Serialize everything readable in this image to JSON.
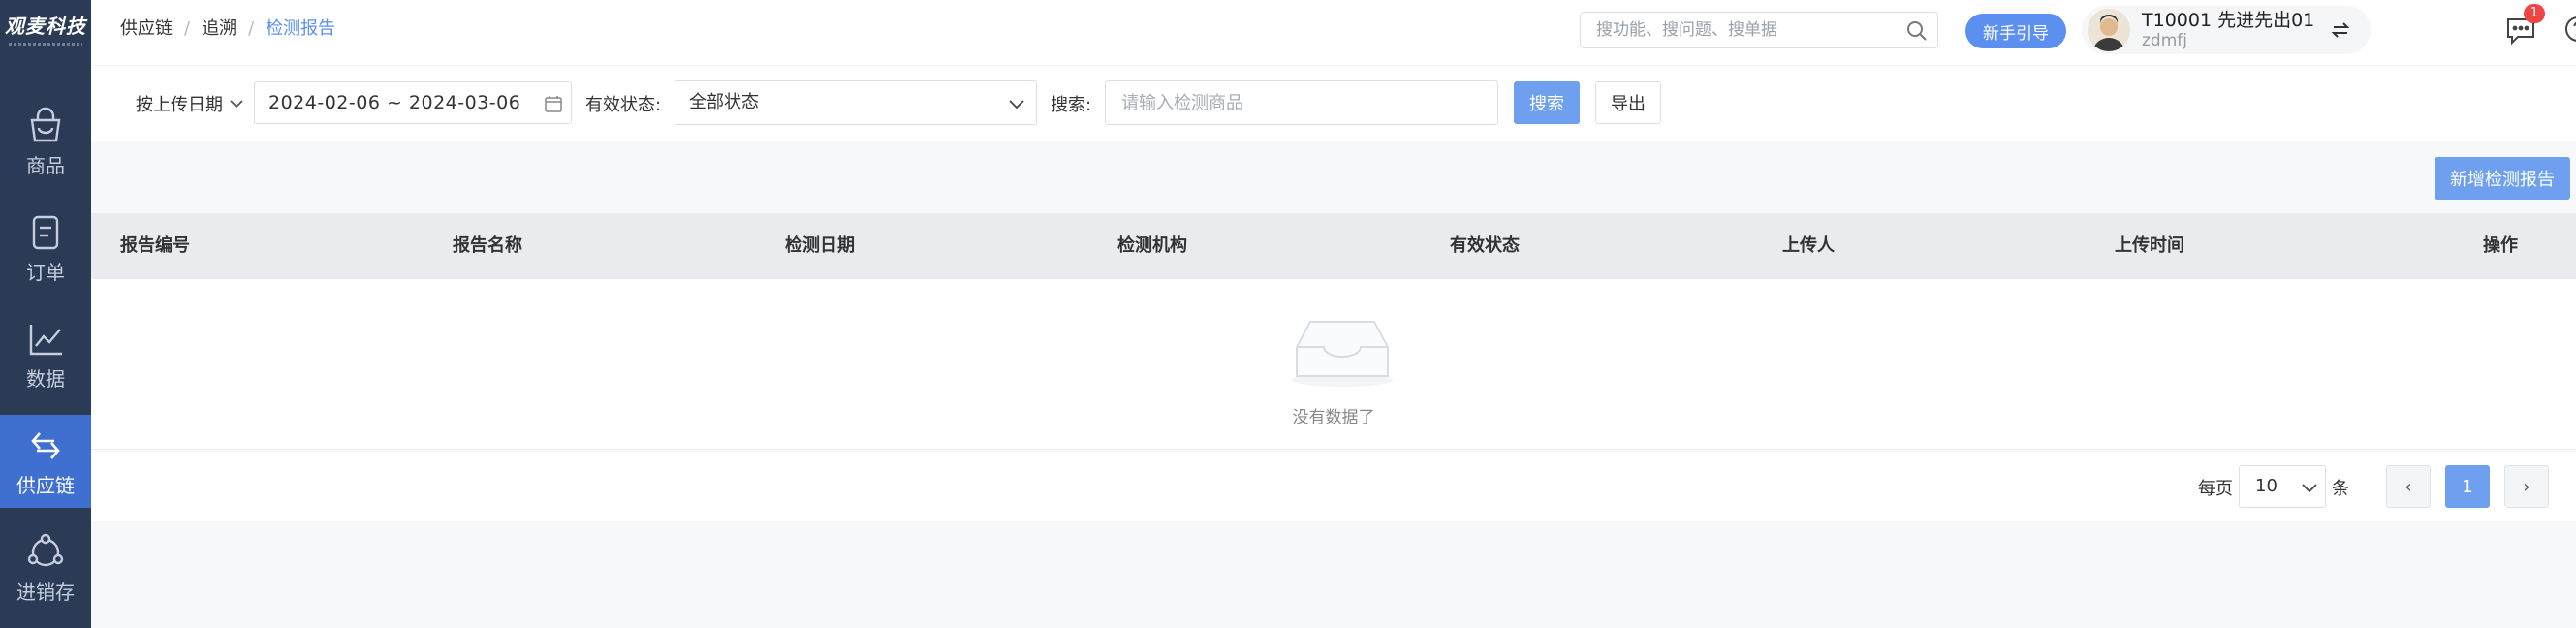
{
  "brand": {
    "logo_text": "观麦科技"
  },
  "sidebar": {
    "items": [
      {
        "label": "商品",
        "icon": "bag-icon"
      },
      {
        "label": "订单",
        "icon": "order-icon"
      },
      {
        "label": "数据",
        "icon": "chart-icon"
      },
      {
        "label": "供应链",
        "icon": "exchange-icon",
        "active": true
      },
      {
        "label": "进销存",
        "icon": "cycle-icon"
      }
    ]
  },
  "header": {
    "breadcrumb": [
      "供应链",
      "追溯",
      "检测报告"
    ],
    "search_placeholder": "搜功能、搜问题、搜单据",
    "guide_label": "新手引导",
    "user_name": "T10001 先进先出01",
    "user_id": "zdmfj",
    "notification_count": "1"
  },
  "filter": {
    "date_type": "按上传日期",
    "date_range": "2024-02-06 ~ 2024-03-06",
    "status_label": "有效状态:",
    "status_value": "全部状态",
    "keyword_label": "搜索:",
    "keyword_placeholder": "请输入检测商品",
    "search_button": "搜索",
    "export_button": "导出"
  },
  "content": {
    "add_button": "新增检测报告",
    "columns": [
      "报告编号",
      "报告名称",
      "检测日期",
      "检测机构",
      "有效状态",
      "上传人",
      "上传时间",
      "操作"
    ],
    "empty_text": "没有数据了"
  },
  "pagination": {
    "per_page_label": "每页",
    "per_page_value": "10",
    "unit_label": "条",
    "prev": "‹",
    "current_page": "1",
    "next": "›"
  },
  "colors": {
    "sidebar_bg": "#2b3a55",
    "accent": "#5b8ff0",
    "active_nav": "#3f6fd0"
  }
}
